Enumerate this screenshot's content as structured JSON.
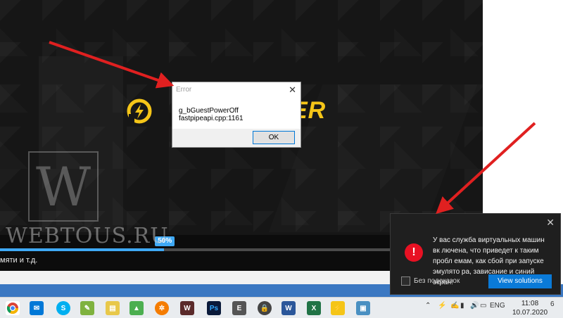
{
  "error_dialog": {
    "title": "Error",
    "message": "g_bGuestPowerOff fastpipeapi.cpp:1161",
    "ok_label": "OK"
  },
  "app": {
    "logo_text": "LDPLAYER",
    "logo_visible_text": "ER",
    "watermark_letter": "W",
    "watermark_site": "WEBTOUS.RU",
    "progress_percent": 50,
    "progress_label": "50%",
    "status_text": "мяти и т.д."
  },
  "notification": {
    "message": "У вас служба виртуальных машин вк лючена, что приведет к таким пробл емам, как сбой при запуске эмулято ра, зависание и синий экран!",
    "checkbox_label": "Без подсказок",
    "button_label": "View solutions"
  },
  "taskbar": {
    "tray_language": "ENG",
    "time": "11:08",
    "date": "10.07.2020",
    "notification_count": "6"
  },
  "colors": {
    "accent": "#3fa9f5",
    "logo": "#f5c518",
    "error": "#e81123",
    "button": "#0a7ad8",
    "arrow": "#e02020"
  }
}
